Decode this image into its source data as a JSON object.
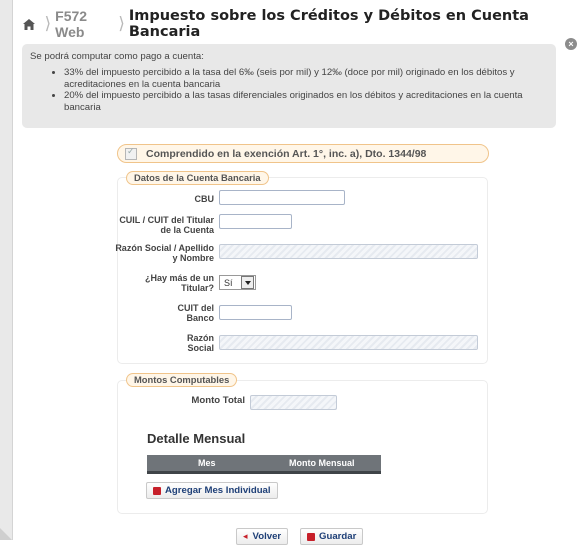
{
  "header": {
    "app_name": "F572 Web",
    "title": "Impuesto sobre los Créditos y Débitos en Cuenta Bancaria"
  },
  "info": {
    "intro": "Se podrá computar como pago a cuenta:",
    "items": [
      "33% del impuesto percibido a la tasa del 6‰ (seis por mil) y 12‰ (doce por mil) originado en los débitos y acreditaciones en la cuenta bancaria",
      "20% del impuesto percibido a las tasas diferenciales originados en los débitos y acreditaciones en la cuenta bancaria"
    ]
  },
  "exemption_label": "Comprendido en la exención Art. 1°, inc. a), Dto. 1344/98",
  "bank_account": {
    "legend": "Datos de la Cuenta Bancaria",
    "cbu_label": "CBU",
    "cuil_label": "CUIL / CUIT del Titular de la Cuenta",
    "razon_label": "Razón Social / Apellido y Nombre",
    "multi_holder_label": "¿Hay más de un Titular?",
    "multi_holder_value": "Sí",
    "cuit_banco_label": "CUIT del Banco",
    "razon_social_label": "Razón Social"
  },
  "amounts": {
    "legend": "Montos Computables",
    "monto_total_label": "Monto Total",
    "detalle_title": "Detalle Mensual",
    "col_mes": "Mes",
    "col_monto": "Monto Mensual",
    "add_button": "Agregar Mes Individual"
  },
  "actions": {
    "back": "Volver",
    "save": "Guardar"
  },
  "colors": {
    "accent_orange_border": "#f0c48a",
    "link_blue": "#1e3f77",
    "icon_red": "#c7202a"
  }
}
